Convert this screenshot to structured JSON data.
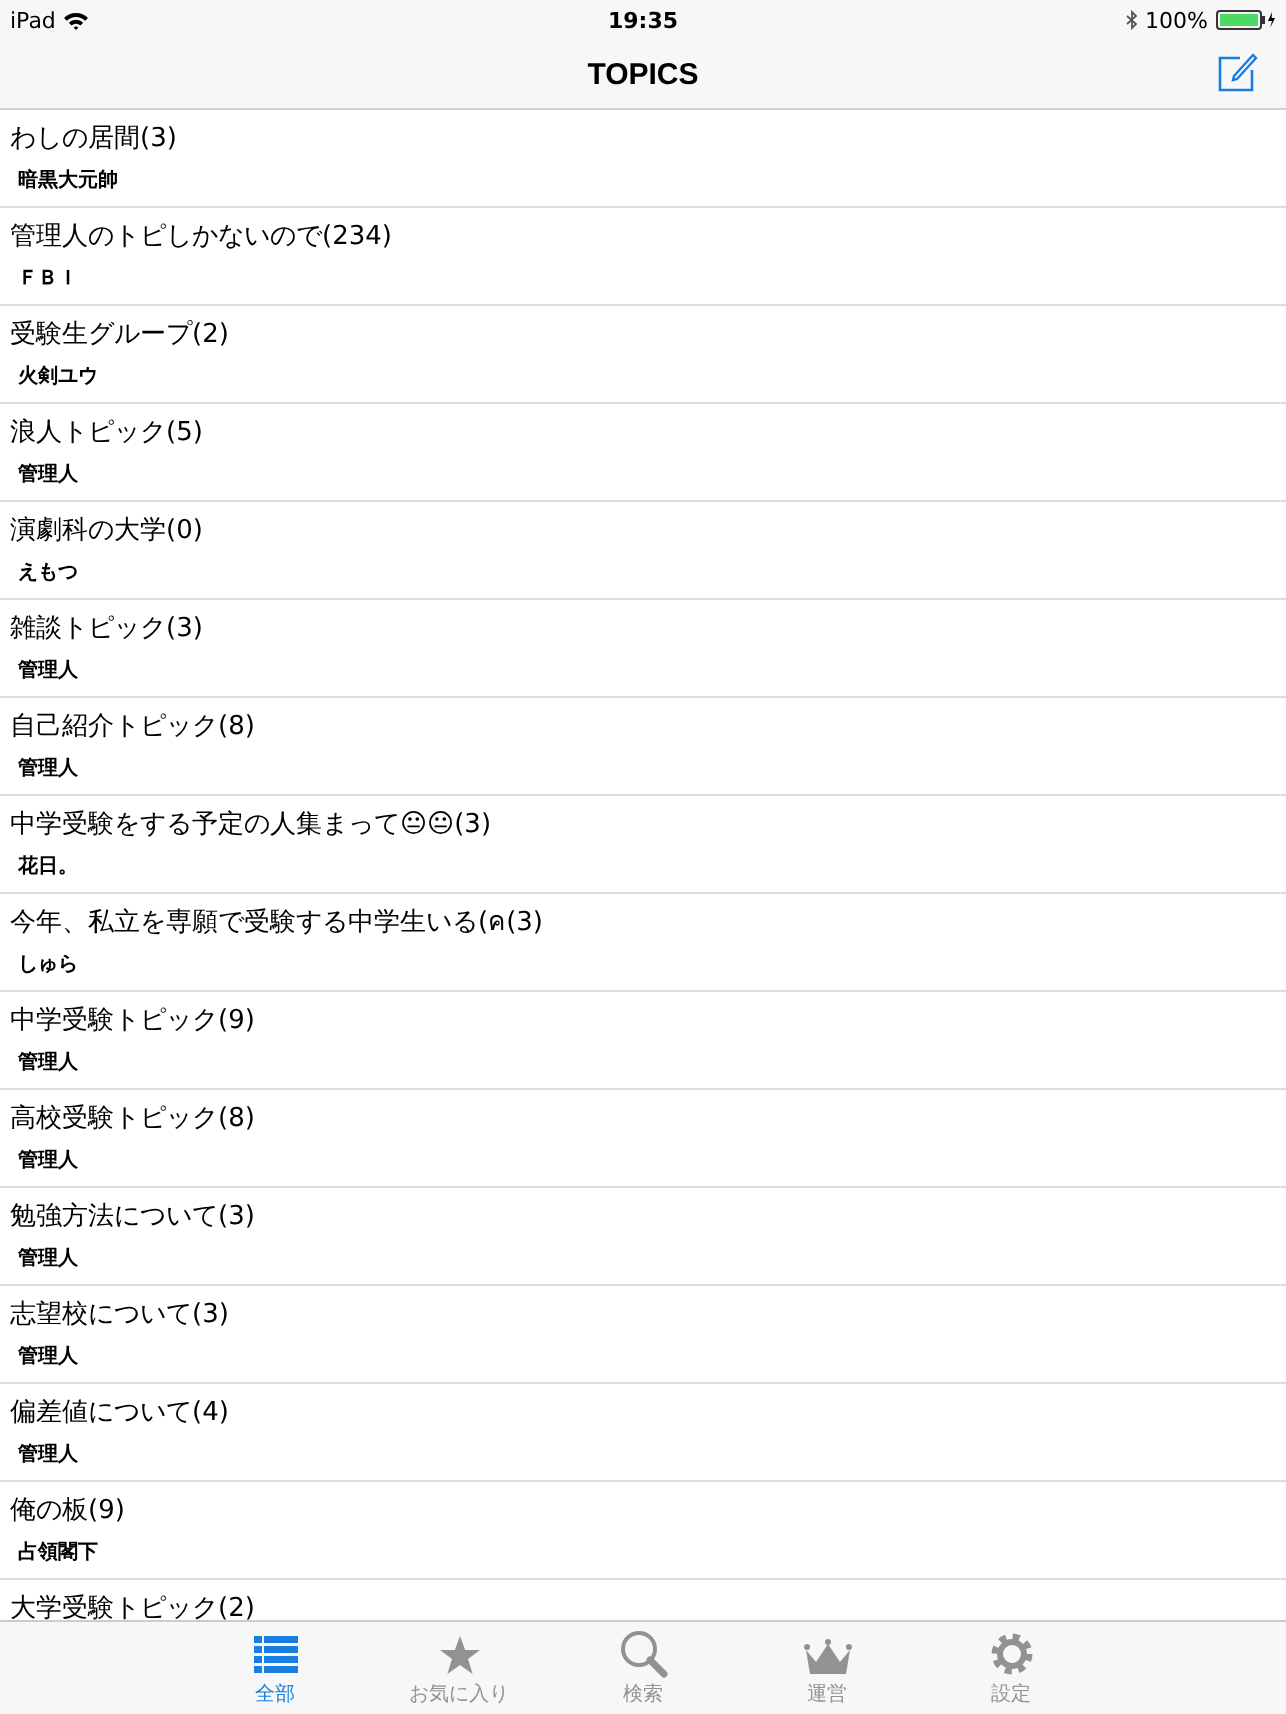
{
  "status_bar": {
    "device": "iPad",
    "time": "19:35",
    "battery": "100%"
  },
  "nav_bar": {
    "title": "TOPICS"
  },
  "topics": [
    {
      "title": "わしの居間(3)",
      "author": "暗黒大元帥"
    },
    {
      "title": "管理人のトピしかないので(234)",
      "author": "ＦＢＩ"
    },
    {
      "title": "受験生グループ(2)",
      "author": "火剣ユウ"
    },
    {
      "title": "浪人トピック(5)",
      "author": "管理人"
    },
    {
      "title": "演劇科の大学(0)",
      "author": "えもつ"
    },
    {
      "title": "雑談トピック(3)",
      "author": "管理人"
    },
    {
      "title": "自己紹介トピック(8)",
      "author": "管理人"
    },
    {
      "title": "中学受験をする予定の人集まって😐😐(3)",
      "author": "花日。"
    },
    {
      "title": "今年、私立を専願で受験する中学生いる(ค(3)",
      "author": "しゅら"
    },
    {
      "title": "中学受験トピック(9)",
      "author": "管理人"
    },
    {
      "title": "高校受験トピック(8)",
      "author": "管理人"
    },
    {
      "title": "勉強方法について(3)",
      "author": "管理人"
    },
    {
      "title": "志望校について(3)",
      "author": "管理人"
    },
    {
      "title": "偏差値について(4)",
      "author": "管理人"
    },
    {
      "title": "俺の板(9)",
      "author": "占領閣下"
    },
    {
      "title": "大学受験トピック(2)"
    }
  ],
  "tab_bar": [
    {
      "label": "全部",
      "selected": true
    },
    {
      "label": "お気に入り",
      "selected": false
    },
    {
      "label": "検索",
      "selected": false
    },
    {
      "label": "運営",
      "selected": false
    },
    {
      "label": "設定",
      "selected": false
    }
  ]
}
